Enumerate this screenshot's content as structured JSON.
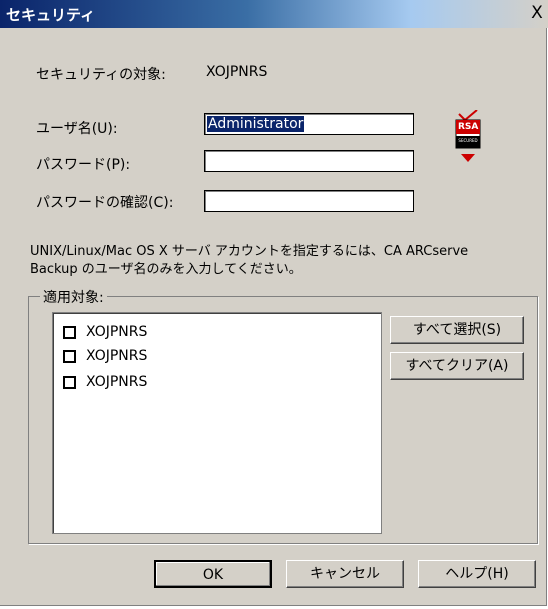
{
  "window": {
    "title": "セキュリティ",
    "close_glyph": "X"
  },
  "security_target": {
    "label": "セキュリティの対象:",
    "value": "XOJPNRS"
  },
  "form": {
    "username": {
      "label": "ユーザ名(U):",
      "value": "Administrator"
    },
    "password": {
      "label": "パスワード(P):",
      "value": ""
    },
    "confirm": {
      "label": "パスワードの確認(C):",
      "value": ""
    }
  },
  "rsa_logo": {
    "text": "RSA",
    "subtext": "SECURED",
    "accent_color": "#cc0000"
  },
  "note": {
    "line1": "UNIX/Linux/Mac OS X サーバ アカウントを指定するには、CA ARCserve",
    "line2": "Backup のユーザ名のみを入力してください。"
  },
  "apply_group": {
    "title": "適用対象:",
    "items": [
      {
        "label": "XOJPNRS",
        "checked": false
      },
      {
        "label": "XOJPNRS",
        "checked": false
      },
      {
        "label": "XOJPNRS",
        "checked": false
      }
    ],
    "select_all": "すべて選択(S)",
    "clear_all": "すべてクリア(A)"
  },
  "buttons": {
    "ok": "OK",
    "cancel": "キャンセル",
    "help": "ヘルプ(H)"
  }
}
